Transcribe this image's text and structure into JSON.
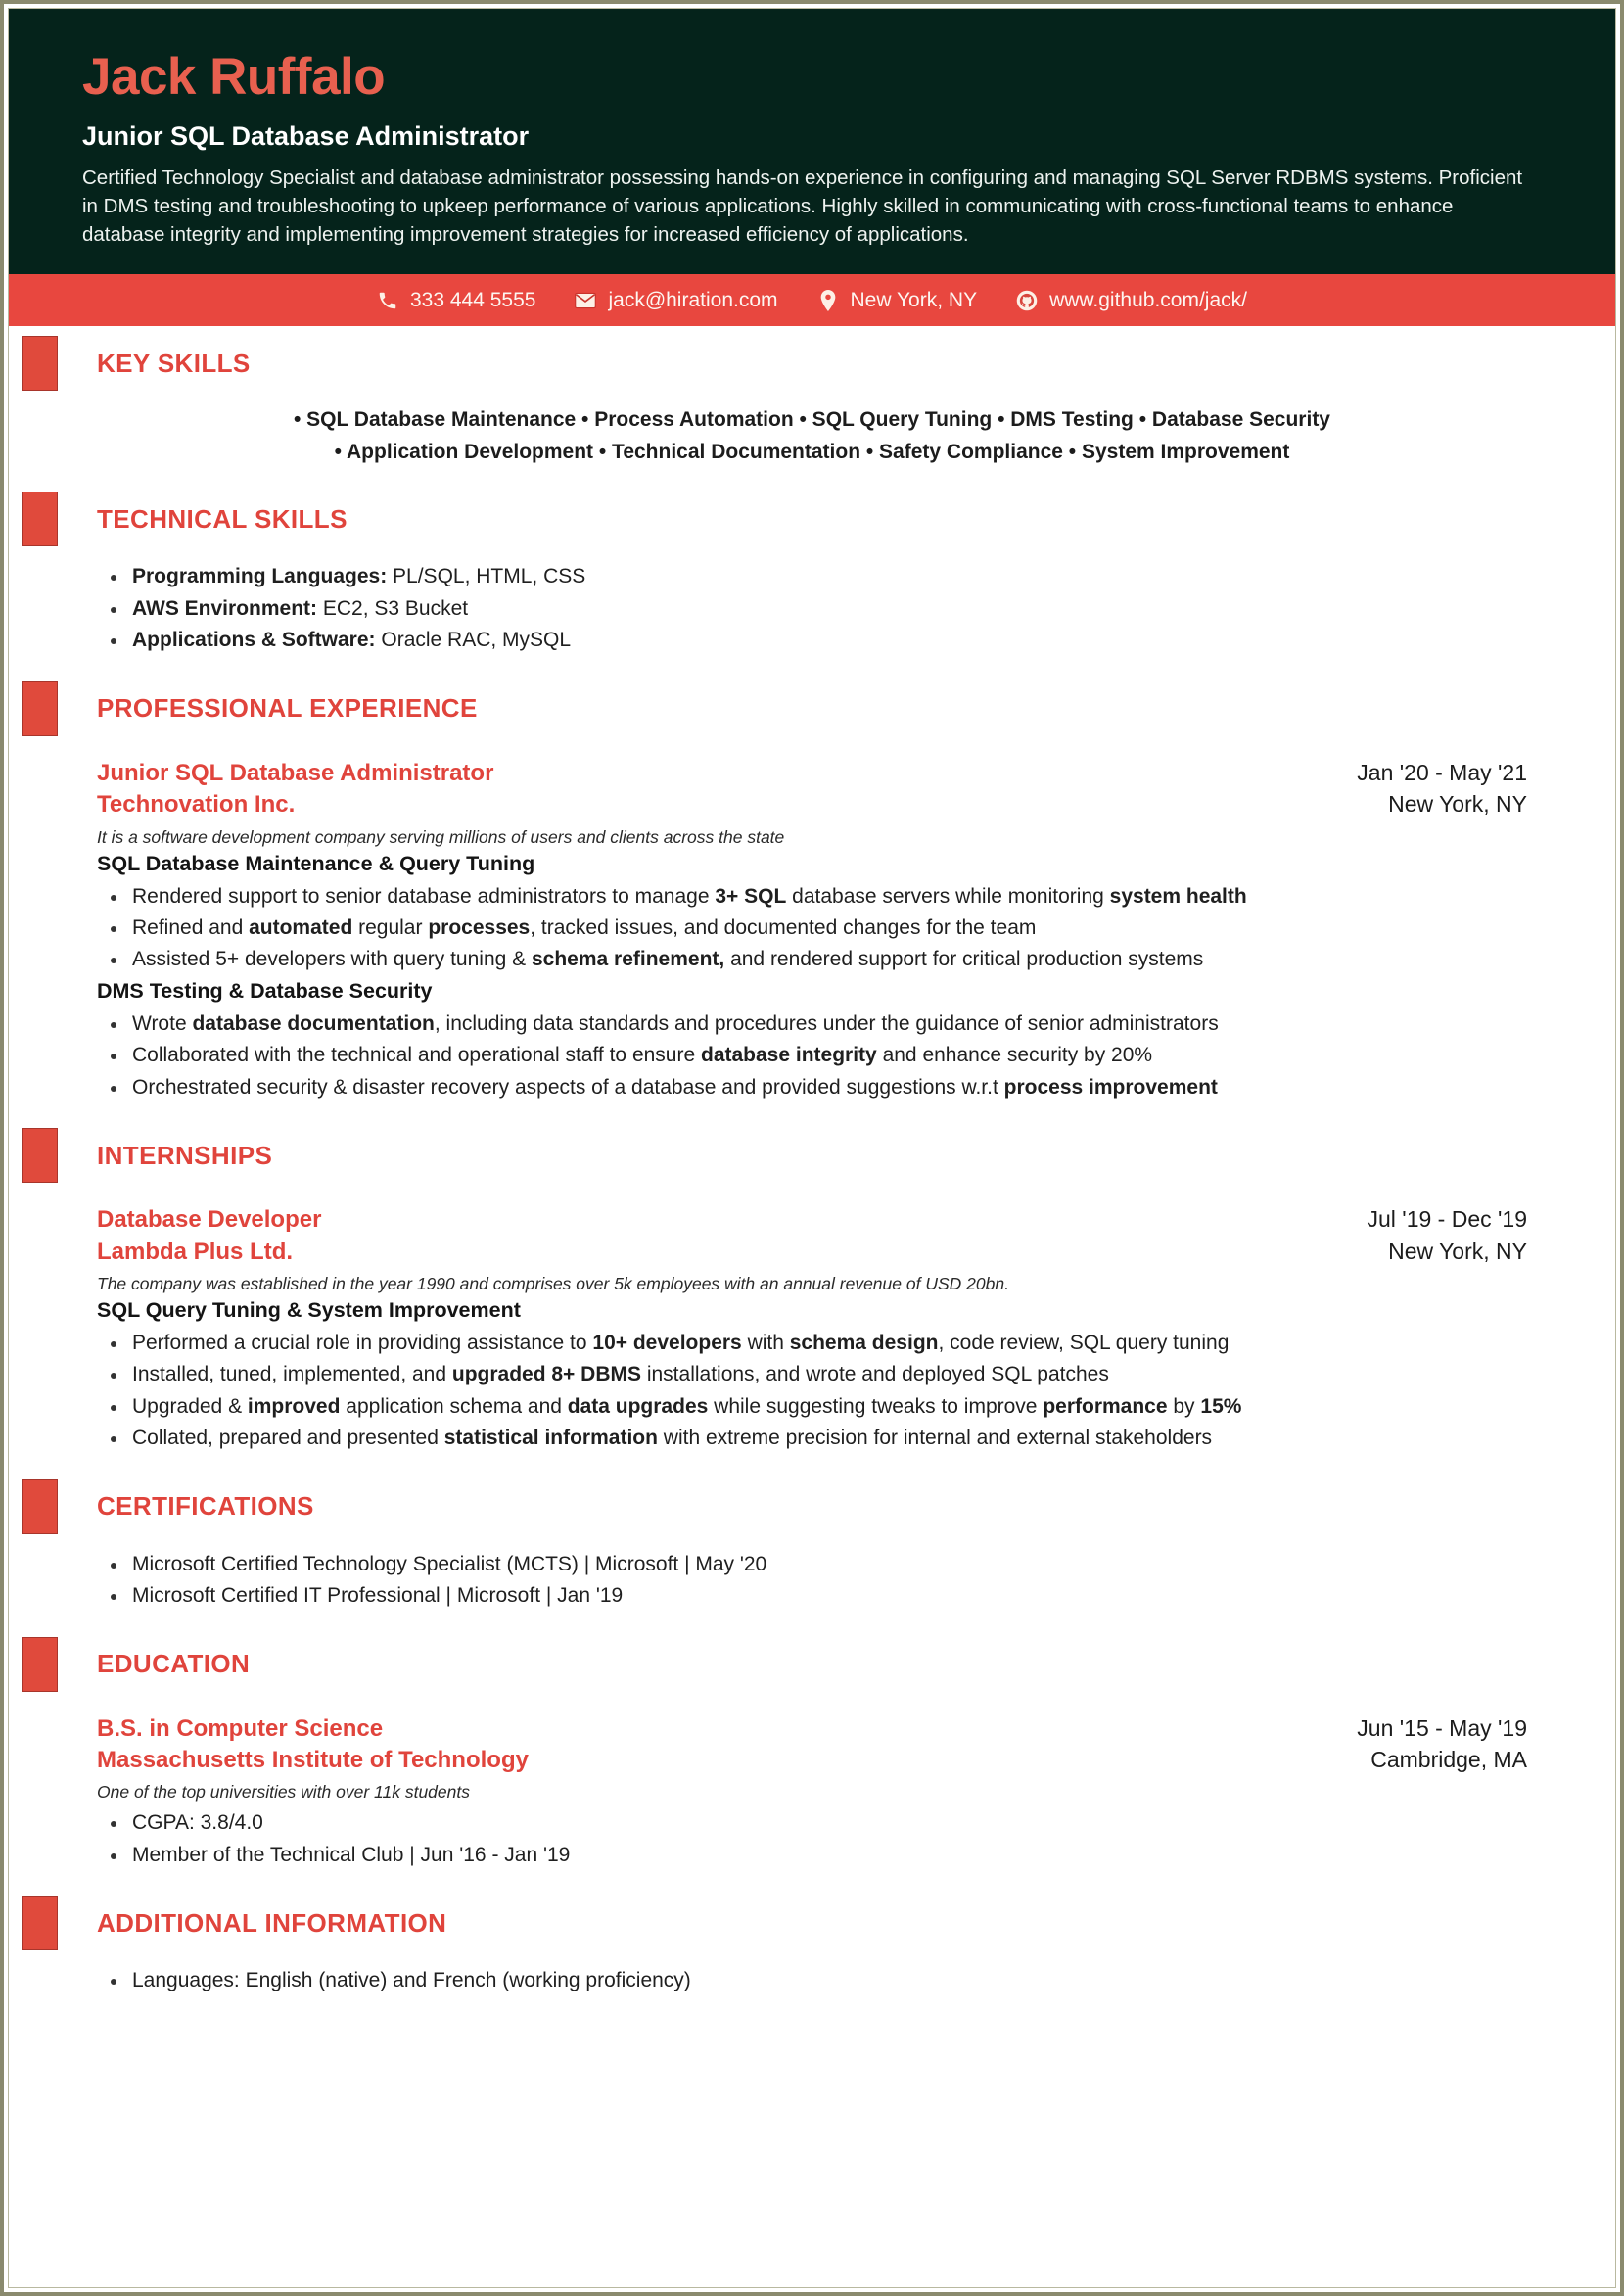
{
  "colors": {
    "header_bg": "#05231b",
    "accent_red": "#e0443c",
    "contact_bar": "#e8473f",
    "name_color": "#e8604f"
  },
  "header": {
    "name": "Jack Ruffalo",
    "designation": "Junior SQL Database Administrator",
    "summary": "Certified Technology Specialist and database administrator possessing hands-on experience in configuring and managing SQL Server RDBMS systems. Proficient in DMS testing and troubleshooting to upkeep performance of various applications. Highly skilled in communicating with cross-functional teams to enhance database integrity and implementing improvement strategies for increased efficiency of applications."
  },
  "contact": [
    {
      "icon": "phone-icon",
      "value": "333 444 5555"
    },
    {
      "icon": "email-icon",
      "value": "jack@hiration.com"
    },
    {
      "icon": "location-pin-icon",
      "value": "New York, NY"
    },
    {
      "icon": "github-icon",
      "value": "www.github.com/jack/"
    }
  ],
  "sections": {
    "key_skills": {
      "title": "KEY SKILLS",
      "line1": "• SQL Database Maintenance • Process Automation • SQL Query Tuning • DMS Testing • Database Security",
      "line2": "• Application Development • Technical Documentation • Safety Compliance • System Improvement"
    },
    "technical_skills": {
      "title": "TECHNICAL SKILLS",
      "items": [
        {
          "label": "Programming Languages:",
          "value": " PL/SQL, HTML, CSS"
        },
        {
          "label": "AWS Environment:",
          "value": " EC2, S3 Bucket"
        },
        {
          "label": "Applications & Software:",
          "value": " Oracle RAC, MySQL"
        }
      ]
    },
    "professional_experience": {
      "title": "PROFESSIONAL EXPERIENCE",
      "entry": {
        "title": "Junior SQL Database Administrator",
        "dates": "Jan '20 -  May '21",
        "org": "Technovation Inc.",
        "location": "New York, NY",
        "description": "It is a software development company serving millions of users and clients across the state",
        "buckets": [
          {
            "heading": "SQL Database Maintenance & Query Tuning",
            "points": [
              "Rendered support to senior database administrators to manage <b>3+ SQL</b> database servers while monitoring <b>system health</b>",
              "Refined and <b>automated</b> regular <b>processes</b>, tracked issues, and documented changes for the team",
              "Assisted 5+ developers with query tuning &amp; <b>schema refinement,</b> and rendered support for critical production systems"
            ]
          },
          {
            "heading": "DMS Testing & Database Security",
            "points": [
              "Wrote <b>database documentation</b>, including data standards and procedures under the guidance of senior administrators",
              "Collaborated with the technical and operational staff to ensure <b>database integrity</b> and enhance security by 20%",
              "Orchestrated security &amp; disaster recovery aspects of a database and provided suggestions w.r.t <b>process improvement</b>"
            ]
          }
        ]
      }
    },
    "internships": {
      "title": "INTERNSHIPS",
      "entry": {
        "title": "Database Developer",
        "dates": "Jul '19 -  Dec '19",
        "org": "Lambda Plus Ltd.",
        "location": "New York, NY",
        "description": "The company was established in the year 1990 and comprises over 5k employees with an annual revenue of USD 20bn.",
        "buckets": [
          {
            "heading": "SQL Query Tuning & System Improvement",
            "points": [
              "Performed a crucial role in providing assistance to <b>10+ developers</b> with <b>schema design</b>, code review, SQL query tuning",
              "Installed, tuned, implemented, and <b>upgraded 8+ DBMS</b> installations, and wrote and deployed SQL patches",
              "Upgraded &amp; <b>improved</b> application schema and <b>data upgrades</b> while suggesting tweaks to improve <b>performance</b> by <b>15%</b>",
              "Collated, prepared and presented <b>statistical information</b> with extreme precision for internal and external stakeholders"
            ]
          }
        ]
      }
    },
    "certifications": {
      "title": "CERTIFICATIONS",
      "items": [
        "Microsoft Certified Technology Specialist (MCTS) | Microsoft | May '20",
        "Microsoft Certified IT Professional | Microsoft | Jan '19"
      ]
    },
    "education": {
      "title": "EDUCATION",
      "entry": {
        "degree": "B.S. in Computer Science",
        "dates": "Jun '15 -  May '19",
        "school": "Massachusetts Institute of Technology",
        "location": "Cambridge, MA",
        "description": "One of the top universities with over 11k students",
        "points": [
          "CGPA: 3.8/4.0",
          "Member of the Technical Club | Jun '16 - Jan '19"
        ]
      }
    },
    "additional_information": {
      "title": "ADDITIONAL INFORMATION",
      "items": [
        "Languages: English (native) and French (working proficiency)"
      ]
    }
  }
}
